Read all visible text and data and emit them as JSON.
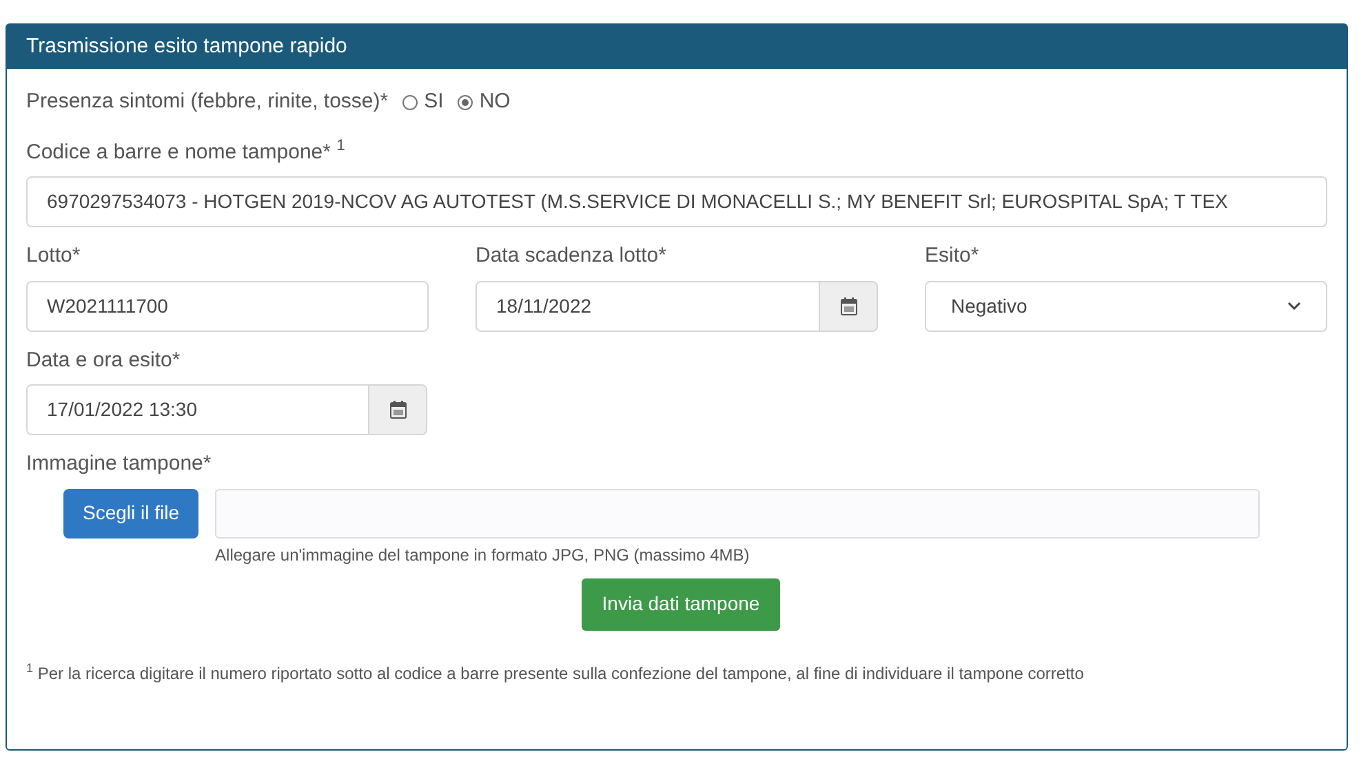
{
  "panel": {
    "title": "Trasmissione esito tampone rapido"
  },
  "symptoms": {
    "label": "Presenza sintomi (febbre, rinite, tosse)*",
    "options": [
      {
        "label": "SI",
        "selected": false
      },
      {
        "label": "NO",
        "selected": true
      }
    ]
  },
  "barcode": {
    "label": "Codice a barre e nome tampone* $^{1}$",
    "value": "6970297534073 - HOTGEN 2019-NCOV AG AUTOTEST (M.S.SERVICE DI MONACELLI S.; MY BENEFIT Srl; EUROSPITAL SpA; T TEX"
  },
  "lot": {
    "label": "Lotto*",
    "value": "W2021111700"
  },
  "expiry": {
    "label": "Data scadenza lotto*",
    "value": "18/11/2022"
  },
  "result": {
    "label": "Esito*",
    "value": "Negativo"
  },
  "result_datetime": {
    "label": "Data e ora esito*",
    "value": "17/01/2022 13:30"
  },
  "image": {
    "label": "Immagine tampone*",
    "button": "Scegli il file",
    "help": "Allegare un'immagine del tampone in formato JPG, PNG (massimo 4MB)"
  },
  "submit": "Invia dati tampone",
  "footnote": "$^{1}$ Per la ricerca digitare il numero riportato sotto al codice a barre presente sulla confezione del tampone, al fine di individuare il tampone corretto"
}
